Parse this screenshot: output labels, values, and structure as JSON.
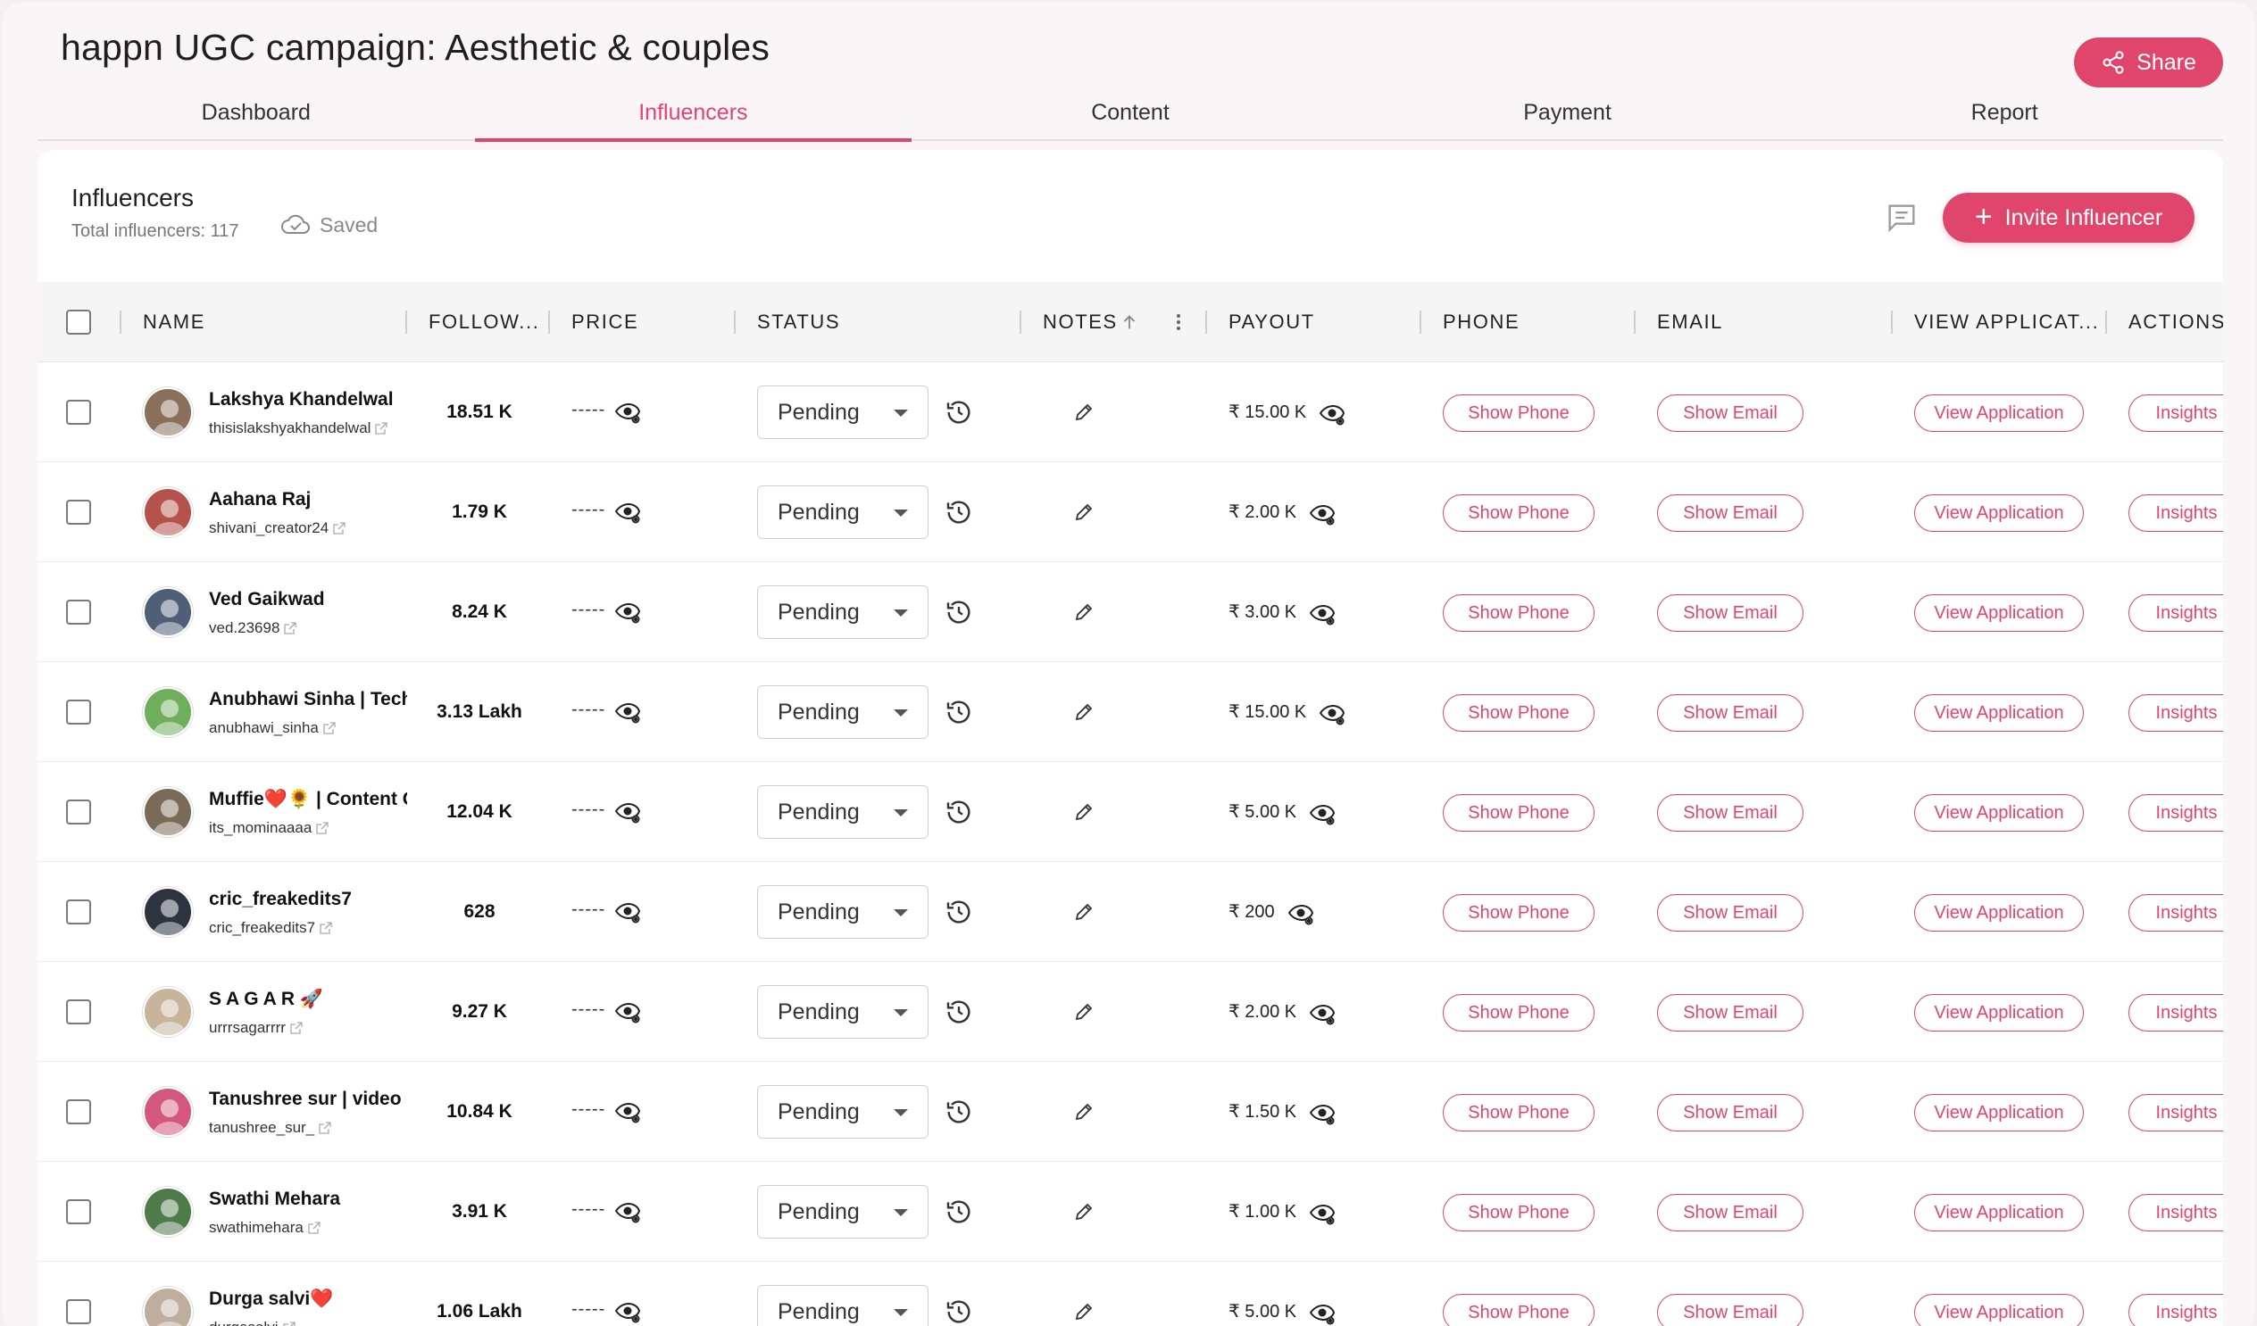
{
  "app": {
    "title": "happn UGC campaign: Aesthetic & couples",
    "share_label": "Share",
    "accent_color": "#e0456b"
  },
  "tabs": [
    {
      "label": "Dashboard",
      "active": false
    },
    {
      "label": "Influencers",
      "active": true
    },
    {
      "label": "Content",
      "active": false
    },
    {
      "label": "Payment",
      "active": false
    },
    {
      "label": "Report",
      "active": false
    }
  ],
  "panel": {
    "title": "Influencers",
    "subtitle": "Total influencers: 117",
    "saved_label": "Saved",
    "invite_label": "Invite Influencer",
    "chat_icon": "message-square-icon"
  },
  "table": {
    "columns": {
      "name": "NAME",
      "followers": "FOLLOW...",
      "price": "PRICE",
      "status": "STATUS",
      "notes": "NOTES",
      "payout": "PAYOUT",
      "phone": "PHONE",
      "email": "EMAIL",
      "view_application": "VIEW APPLICAT...",
      "actions": "ACTIONS"
    },
    "notes_sort": "ascending",
    "row_buttons": {
      "phone": "Show Phone",
      "email": "Show Email",
      "application": "View Application",
      "insights": "Insights"
    },
    "rows": [
      {
        "name": "Lakshya Khandelwal",
        "handle": "thisislakshyakhandelwal",
        "followers": "18.51 K",
        "price": "-----",
        "status": "Pending",
        "payout": "₹ 15.00 K",
        "avatar_color": "#8a6f5a"
      },
      {
        "name": "Aahana Raj",
        "handle": "shivani_creator24",
        "followers": "1.79 K",
        "price": "-----",
        "status": "Pending",
        "payout": "₹ 2.00 K",
        "avatar_color": "#b5524b"
      },
      {
        "name": "Ved Gaikwad",
        "handle": "ved.23698",
        "followers": "8.24 K",
        "price": "-----",
        "status": "Pending",
        "payout": "₹ 3.00 K",
        "avatar_color": "#4f5f78"
      },
      {
        "name": "Anubhawi Sinha | Tech",
        "handle": "anubhawi_sinha",
        "followers": "3.13 Lakh",
        "price": "-----",
        "status": "Pending",
        "payout": "₹ 15.00 K",
        "avatar_color": "#6fae5a"
      },
      {
        "name": "Muffie❤️🌻 | Content C",
        "handle": "its_mominaaaa",
        "followers": "12.04 K",
        "price": "-----",
        "status": "Pending",
        "payout": "₹ 5.00 K",
        "avatar_color": "#7a6a58"
      },
      {
        "name": "cric_freakedits7",
        "handle": "cric_freakedits7",
        "followers": "628",
        "price": "-----",
        "status": "Pending",
        "payout": "₹ 200",
        "avatar_color": "#2d3440"
      },
      {
        "name": "S A G A R 🚀",
        "handle": "urrrsagarrrr",
        "followers": "9.27 K",
        "price": "-----",
        "status": "Pending",
        "payout": "₹ 2.00 K",
        "avatar_color": "#c7b49a"
      },
      {
        "name": "Tanushree sur | video c",
        "handle": "tanushree_sur_",
        "followers": "10.84 K",
        "price": "-----",
        "status": "Pending",
        "payout": "₹ 1.50 K",
        "avatar_color": "#d4577e"
      },
      {
        "name": "Swathi Mehara",
        "handle": "swathimehara",
        "followers": "3.91 K",
        "price": "-----",
        "status": "Pending",
        "payout": "₹ 1.00 K",
        "avatar_color": "#4f7a4a"
      },
      {
        "name": "Durga salvi❤️",
        "handle": "durgasalvi",
        "followers": "1.06 Lakh",
        "price": "-----",
        "status": "Pending",
        "payout": "₹ 5.00 K",
        "avatar_color": "#bfae9e"
      }
    ]
  }
}
